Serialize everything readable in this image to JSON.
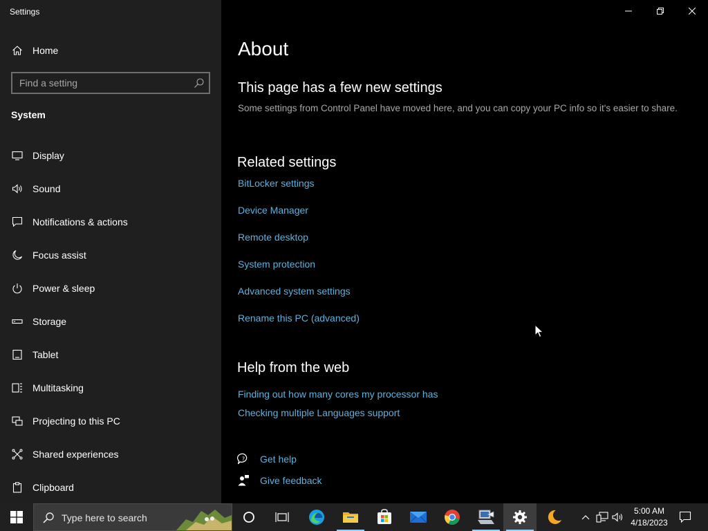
{
  "window": {
    "title": "Settings",
    "controls": [
      "minimize",
      "maximize",
      "close"
    ]
  },
  "sidebar": {
    "home_label": "Home",
    "search_placeholder": "Find a setting",
    "section_label": "System",
    "items": [
      {
        "label": "Display",
        "icon": "display-icon"
      },
      {
        "label": "Sound",
        "icon": "sound-icon"
      },
      {
        "label": "Notifications & actions",
        "icon": "notifications-icon"
      },
      {
        "label": "Focus assist",
        "icon": "moon-icon"
      },
      {
        "label": "Power & sleep",
        "icon": "power-icon"
      },
      {
        "label": "Storage",
        "icon": "storage-icon"
      },
      {
        "label": "Tablet",
        "icon": "tablet-icon"
      },
      {
        "label": "Multitasking",
        "icon": "multitasking-icon"
      },
      {
        "label": "Projecting to this PC",
        "icon": "projecting-icon"
      },
      {
        "label": "Shared experiences",
        "icon": "shared-icon"
      },
      {
        "label": "Clipboard",
        "icon": "clipboard-icon"
      }
    ]
  },
  "main": {
    "title": "About",
    "notice_heading": "This page has a few new settings",
    "notice_text": "Some settings from Control Panel have moved here, and you can copy your PC info so it's easier to share.",
    "related": {
      "heading": "Related settings",
      "links": [
        "BitLocker settings",
        "Device Manager",
        "Remote desktop",
        "System protection",
        "Advanced system settings",
        "Rename this PC (advanced)"
      ]
    },
    "help": {
      "heading": "Help from the web",
      "links": [
        "Finding out how many cores my processor has",
        "Checking multiple Languages support"
      ]
    },
    "get_help": "Get help",
    "give_feedback": "Give feedback"
  },
  "taskbar": {
    "search_placeholder": "Type here to search",
    "apps": [
      "cortana",
      "task-view",
      "edge",
      "file-explorer",
      "microsoft-store",
      "mail",
      "chrome",
      "network-app",
      "settings",
      "night-app"
    ],
    "time": "5:00 AM",
    "date": "4/18/2023"
  },
  "colors": {
    "sidebar_bg": "#1f1f1f",
    "main_bg": "#000000",
    "link": "#5fb2dc",
    "taskbar_bg": "#202020"
  }
}
